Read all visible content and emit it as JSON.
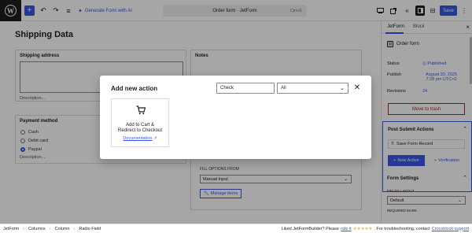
{
  "toolbar": {
    "add_label": "+",
    "undo_label": "↶",
    "redo_label": "↷",
    "list_label": "≡",
    "ai_label": "Generate Form with AI",
    "doc_title": "Order form · JetForm",
    "shortcut": "Ctrl+K",
    "save_label": "Save",
    "more_label": "⋮"
  },
  "canvas": {
    "title": "Shipping Data",
    "shipping": {
      "label": "Shipping address",
      "desc": "Description..."
    },
    "notes": {
      "label": "Notes"
    },
    "payment": {
      "label": "Payment method",
      "options": [
        "Cash",
        "Debit card",
        "Paypal"
      ],
      "selected": "Paypal",
      "desc": "Description..."
    },
    "options_from": {
      "label": "FILL OPTIONS FROM",
      "value": "Manual Input",
      "manage_label": "Manage items"
    }
  },
  "sidebar": {
    "tabs": [
      "JetForm",
      "Block"
    ],
    "active_tab": "JetForm",
    "form_name": "Order form",
    "status": {
      "key": "Status",
      "value": "Published"
    },
    "publish": {
      "key": "Publish",
      "value_line1": "August 20, 2025",
      "value_line2": "7:28 pm UTC+0"
    },
    "revisions": {
      "key": "Revisions",
      "value": "24"
    },
    "trash_label": "Move to trash",
    "post_submit": {
      "title": "Post Submit Actions",
      "action": "Save Form Record",
      "new_action_label": "New Action",
      "verification_label": "Verification"
    },
    "form_settings": {
      "title": "Form Settings",
      "fields_layout_label": "FIELDS LAYOUT",
      "fields_layout_value": "Default",
      "required_mark_label": "REQUIRED MARK"
    }
  },
  "footer": {
    "breadcrumbs": [
      "JetForm",
      "Columns",
      "Column",
      "Radio Field"
    ],
    "liked_text": "Liked JetFormBuilder? Please",
    "rate_link": "rate it",
    "stars": "★★★★★",
    "support_text": ". For troubleshooting, contact",
    "support_link": "Crocoblock support"
  },
  "modal": {
    "title": "Add new action",
    "search_value": "Check",
    "filter_value": "All",
    "card": {
      "title_line1": "Add to Cart &",
      "title_line2": "Redirect to Checkout",
      "doc_label": "Documentation"
    }
  },
  "colors": {
    "accent": "#3858e9",
    "danger": "#cc1818",
    "dark": "#1e1e1e"
  }
}
